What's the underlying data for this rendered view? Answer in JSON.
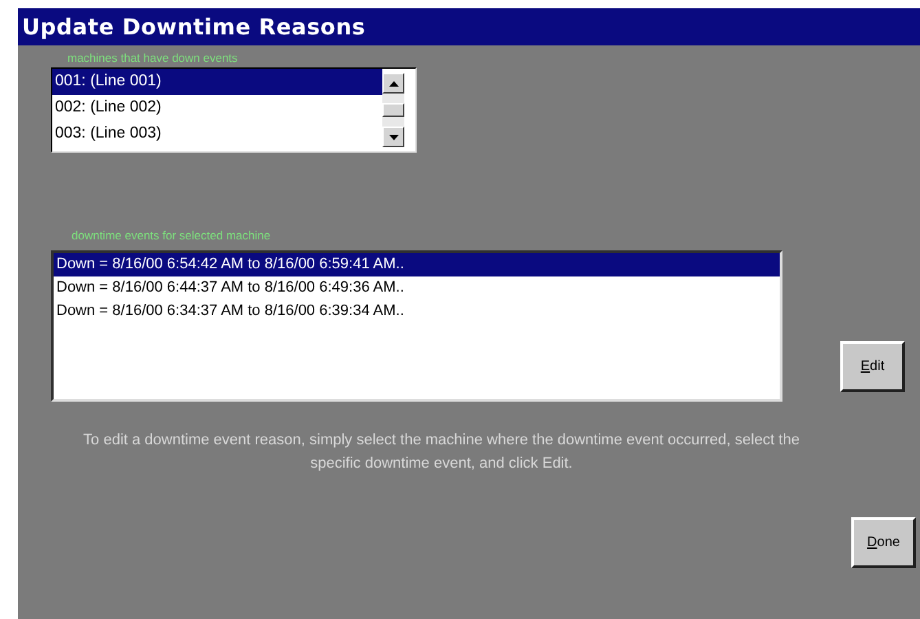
{
  "window": {
    "title": "Update Downtime Reasons"
  },
  "machines": {
    "label": "machines that have down events",
    "items": [
      {
        "text": "001: (Line 001)",
        "selected": true
      },
      {
        "text": "002: (Line 002)",
        "selected": false
      },
      {
        "text": "003: (Line 003)",
        "selected": false
      }
    ]
  },
  "events": {
    "label": "downtime events for selected machine",
    "items": [
      {
        "text": "Down = 8/16/00 6:54:42 AM to 8/16/00 6:59:41 AM..",
        "selected": true
      },
      {
        "text": "Down = 8/16/00 6:44:37 AM to 8/16/00 6:49:36 AM..",
        "selected": false
      },
      {
        "text": "Down = 8/16/00 6:34:37 AM to 8/16/00 6:39:34 AM..",
        "selected": false
      }
    ]
  },
  "edit_button": {
    "label": "Edit"
  },
  "instructions": "To edit a downtime event reason, simply select the machine where the downtime event occurred, select the specific downtime event, and click Edit.",
  "done_button": {
    "label": "Done"
  }
}
